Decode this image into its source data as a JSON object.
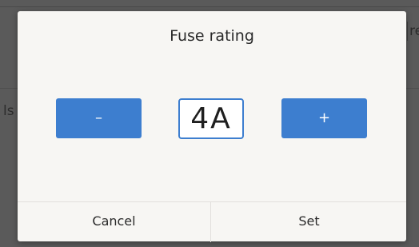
{
  "background": {
    "left_fragment": "ls",
    "right_fragment": "re"
  },
  "dialog": {
    "title": "Fuse rating",
    "decrease_label": "–",
    "increase_label": "+",
    "value": "4A",
    "cancel_label": "Cancel",
    "set_label": "Set"
  },
  "colors": {
    "accent": "#3d7ecf",
    "dialog_bg": "#f7f6f3",
    "overlay": "#5a5a5a"
  }
}
